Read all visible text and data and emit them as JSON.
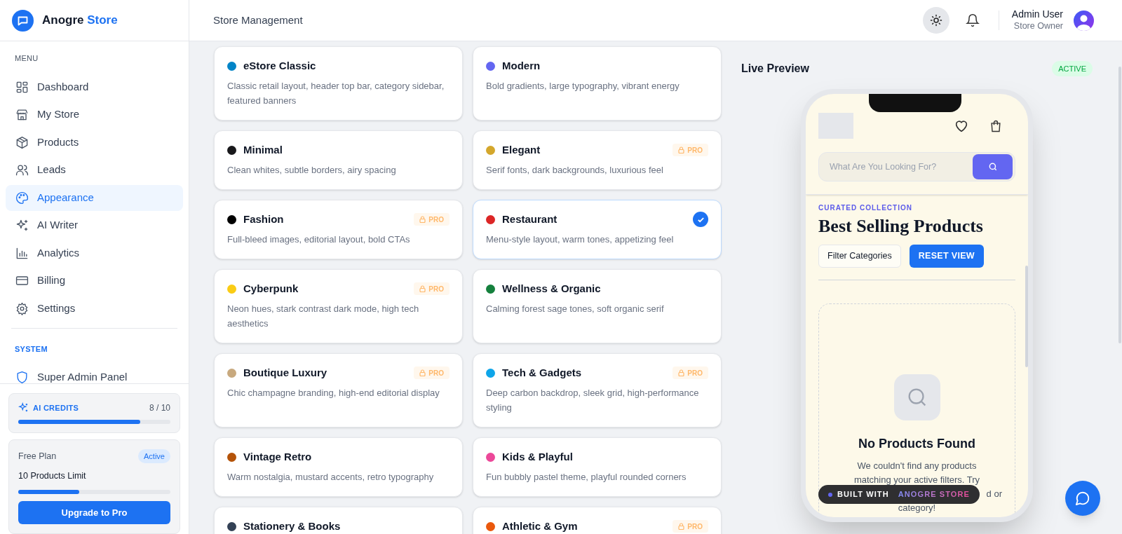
{
  "brand": {
    "name": "Anogre",
    "accent": "Store"
  },
  "header": {
    "title": "Store Management",
    "user": {
      "name": "Admin User",
      "role": "Store Owner"
    }
  },
  "sidebar": {
    "sections": [
      {
        "heading": "MENU",
        "items": [
          {
            "label": "Dashboard",
            "selected": false
          },
          {
            "label": "My Store",
            "selected": false
          },
          {
            "label": "Products",
            "selected": false
          },
          {
            "label": "Leads",
            "selected": false
          },
          {
            "label": "Appearance",
            "selected": true
          },
          {
            "label": "AI Writer",
            "selected": false
          },
          {
            "label": "Analytics",
            "selected": false
          },
          {
            "label": "Billing",
            "selected": false
          },
          {
            "label": "Settings",
            "selected": false
          }
        ]
      },
      {
        "heading": "SYSTEM",
        "items": [
          {
            "label": "Super Admin Panel",
            "selected": false
          }
        ]
      }
    ],
    "credits": {
      "label": "AI CREDITS",
      "count": "8 / 10",
      "level": 0.8
    },
    "plan": {
      "name": "Free Plan",
      "badge": "Active",
      "limit": "10 Products Limit",
      "level": 0.4,
      "button": "Upgrade to Pro"
    }
  },
  "themes": [
    {
      "name": "eStore Classic",
      "description": "Classic retail layout, header top bar, category sidebar, featured banners",
      "color": "#0284c7",
      "pro": false,
      "selected": false
    },
    {
      "name": "Modern",
      "description": "Bold gradients, large typography, vibrant energy",
      "color": "#6366f1",
      "pro": false,
      "selected": false
    },
    {
      "name": "Minimal",
      "description": "Clean whites, subtle borders, airy spacing",
      "color": "#18181b",
      "pro": false,
      "selected": false
    },
    {
      "name": "Elegant",
      "description": "Serif fonts, dark backgrounds, luxurious feel",
      "color": "#d4a72c",
      "pro": true,
      "badge": "PRO",
      "selected": false
    },
    {
      "name": "Fashion",
      "description": "Full-bleed images, editorial layout, bold CTAs",
      "color": "#000000",
      "pro": true,
      "badge": "PRO",
      "selected": false
    },
    {
      "name": "Restaurant",
      "description": "Menu-style layout, warm tones, appetizing feel",
      "color": "#dc2626",
      "pro": false,
      "selected": true
    },
    {
      "name": "Cyberpunk",
      "description": "Neon hues, stark contrast dark mode, high tech aesthetics",
      "color": "#facc15",
      "pro": true,
      "badge": "PRO",
      "selected": false
    },
    {
      "name": "Wellness & Organic",
      "description": "Calming forest sage tones, soft organic serif",
      "color": "#15803d",
      "pro": false,
      "selected": false
    },
    {
      "name": "Boutique Luxury",
      "description": "Chic champagne branding, high-end editorial display",
      "color": "#c8a97e",
      "pro": true,
      "badge": "PRO",
      "selected": false
    },
    {
      "name": "Tech & Gadgets",
      "description": "Deep carbon backdrop, sleek grid, high-performance styling",
      "color": "#0ea5e9",
      "pro": true,
      "badge": "PRO",
      "selected": false
    },
    {
      "name": "Vintage Retro",
      "description": "Warm nostalgia, mustard accents, retro typography",
      "color": "#b45309",
      "pro": false,
      "selected": false
    },
    {
      "name": "Kids & Playful",
      "description": "Fun bubbly pastel theme, playful rounded corners",
      "color": "#ec4899",
      "pro": false,
      "selected": false
    },
    {
      "name": "Stationery & Books",
      "color": "#334155",
      "pro": false,
      "selected": false
    },
    {
      "name": "Athletic & Gym",
      "color": "#ea580c",
      "pro": true,
      "badge": "PRO",
      "selected": false
    }
  ],
  "preview": {
    "title": "Live Preview",
    "badge": "ACTIVE",
    "search_placeholder": "What Are You Looking For?",
    "eyebrow": "CURATED COLLECTION",
    "heading": "Best Selling Products",
    "buttons": [
      "Filter Categories",
      "RESET VIEW"
    ],
    "empty_title": "No Products Found",
    "empty_lines": [
      "We couldn't find any products",
      "matching your active filters. Try",
      "d or",
      "category!"
    ],
    "built_with": {
      "label": "BUILT WITH",
      "brand": "ANOGRE STORE"
    }
  }
}
